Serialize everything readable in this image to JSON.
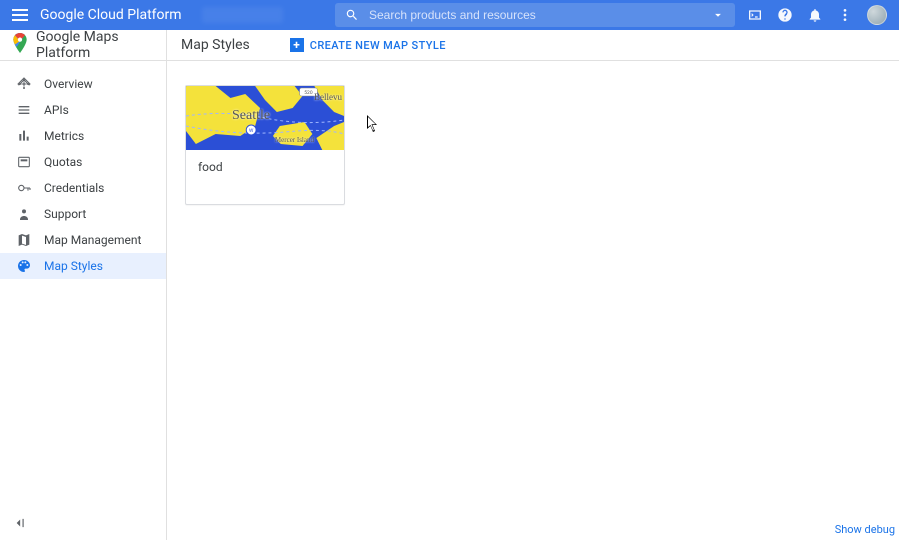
{
  "header": {
    "platform_title": "Google Cloud Platform",
    "search_placeholder": "Search products and resources"
  },
  "product": {
    "brand": "Google Maps Platform",
    "section": "Map Styles",
    "create_label": "CREATE NEW MAP STYLE"
  },
  "sidebar": {
    "items": [
      {
        "label": "Overview"
      },
      {
        "label": "APIs"
      },
      {
        "label": "Metrics"
      },
      {
        "label": "Quotas"
      },
      {
        "label": "Credentials"
      },
      {
        "label": "Support"
      },
      {
        "label": "Map Management"
      },
      {
        "label": "Map Styles"
      }
    ]
  },
  "styles": [
    {
      "name": "food",
      "preview_city": "Seattle",
      "preview_east_label": "Bellevu",
      "preview_island_label": "Mercer Island"
    }
  ],
  "footer": {
    "debug_label": "Show debug"
  }
}
